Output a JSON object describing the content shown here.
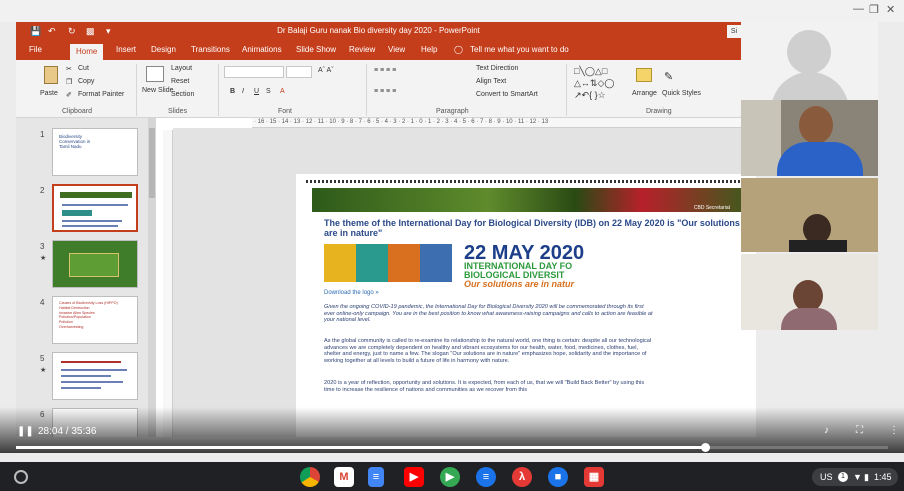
{
  "window": {
    "title": "Dr Balaji Guru nanak Bio diversity day 2020 - PowerPoint",
    "signin": "Si"
  },
  "tabs": [
    "File",
    "Home",
    "Insert",
    "Design",
    "Transitions",
    "Animations",
    "Slide Show",
    "Review",
    "View",
    "Help"
  ],
  "tell_me": "Tell me what you want to do",
  "ribbon": {
    "paste": "Paste",
    "cut": "Cut",
    "copy": "Copy",
    "format_painter": "Format Painter",
    "clipboard": "Clipboard",
    "new_slide": "New Slide",
    "layout": "Layout",
    "reset": "Reset",
    "section": "Section",
    "slides": "Slides",
    "font": "Font",
    "paragraph": "Paragraph",
    "text_direction": "Text Direction",
    "align_text": "Align Text",
    "convert_smartart": "Convert to SmartArt",
    "arrange": "Arrange",
    "quick_styles": "Quick Styles",
    "drawing": "Drawing"
  },
  "ruler": "· 16 · 15 · 14 · 13 · 12 · 11 · 10 · 9 · 8 · 7 · 6 · 5 · 4 · 3 · 2 · 1 · 0 · 1 · 2 · 3 · 4 · 5 · 6 · 7 · 8 · 9 · 10 · 11 · 12 · 13",
  "thumbnails": [
    {
      "num": "1",
      "lines": [
        "Biodiversity",
        "Conservation in",
        "Tamil Nadu"
      ]
    },
    {
      "num": "2",
      "lines": []
    },
    {
      "num": "3",
      "lines": []
    },
    {
      "num": "4",
      "lines": [
        "Causes of Biodiversity Loss (HIPPO)",
        "Habitat Destruction",
        "Invasive Alien Species",
        "Pollution/Population",
        "Pollution",
        "Overharvesting"
      ]
    },
    {
      "num": "5",
      "lines": []
    },
    {
      "num": "6",
      "lines": []
    }
  ],
  "slide": {
    "hero_caption": "CBD Secretariat",
    "heading": "The theme of the International Day for Biological Diversity (IDB) on 22 May 2020 is \"Our solutions are in nature\"",
    "date_big": "22 MAY 2020",
    "date_sub1": "INTERNATIONAL DAY FO",
    "date_sub2": "BIOLOGICAL DIVERSIT",
    "date_sub3": "Our solutions are in natur",
    "download": "Download the logo »",
    "para1": "Given the ongoing COVID-19 pandemic, the International Day for Biological Diversity 2020 will be commemorated through its first ever online-only campaign. You are in the best position to know what awareness-raising campaigns and calls to action are feasible at your national level.",
    "para2": "As the global community is called to re-examine its relationship to the natural world, one thing is certain: despite all our technological advances we are completely dependent on healthy and vibrant ecosystems for our health, water, food, medicines, clothes, fuel, shelter and energy, just to name a few. The slogan \"Our solutions are in nature\" emphasizes hope, solidarity and the importance of working together at all levels to build a future of life in harmony with nature.",
    "para3": "2020 is a year of reflection, opportunity and solutions. It is expected, from each of us, that we will \"Build Back Better\" by using this time to increase the resilience of nations and communities as we recover from this"
  },
  "player": {
    "time": "28:04 / 35:36",
    "progress": 0.79
  },
  "shelf": {
    "locale": "US",
    "badge": "1",
    "clock": "1:45"
  },
  "colors": {
    "accent": "#c43e1c",
    "heading": "#2b4a8a",
    "date_green": "#2b9a3b"
  }
}
